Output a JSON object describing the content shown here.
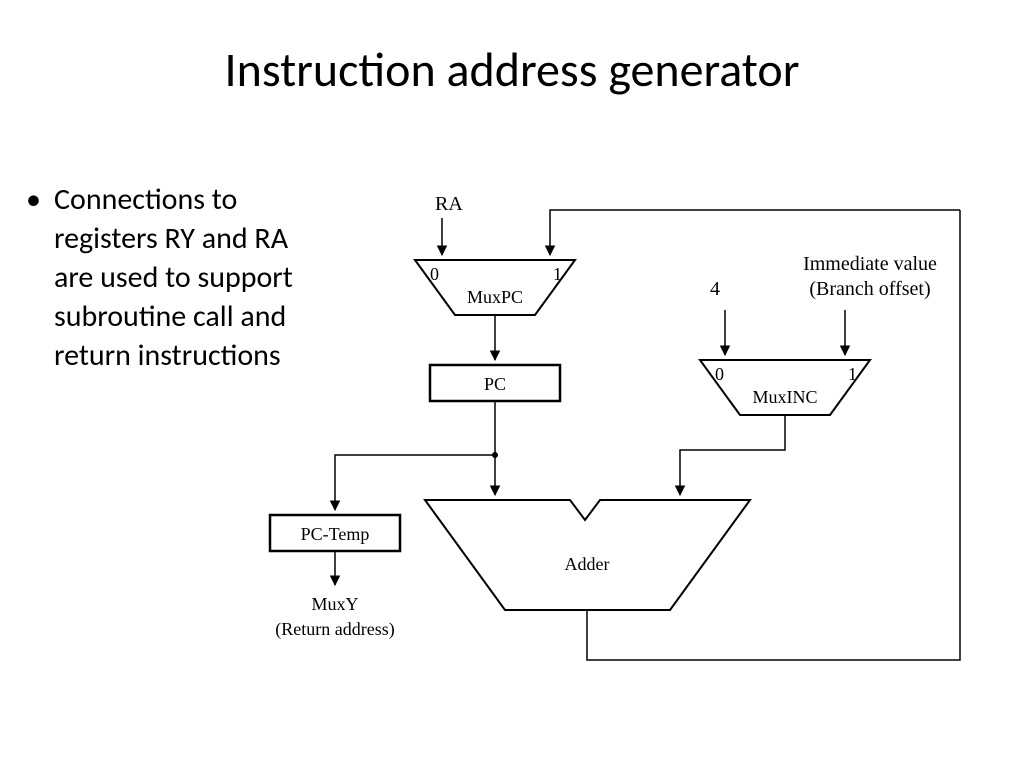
{
  "title": "Instruction address generator",
  "bullet": "Connections to registers RY and RA are used to support subroutine call and return instructions",
  "diagram": {
    "ra_label": "RA",
    "muxpc": {
      "name": "MuxPC",
      "in0": "0",
      "in1": "1"
    },
    "pc": "PC",
    "const4": "4",
    "immediate_l1": "Immediate value",
    "immediate_l2": "(Branch offset)",
    "muxinc": {
      "name": "MuxINC",
      "in0": "0",
      "in1": "1"
    },
    "pctemp": "PC-Temp",
    "muxy_l1": "MuxY",
    "muxy_l2": "(Return address)",
    "adder": "Adder"
  }
}
